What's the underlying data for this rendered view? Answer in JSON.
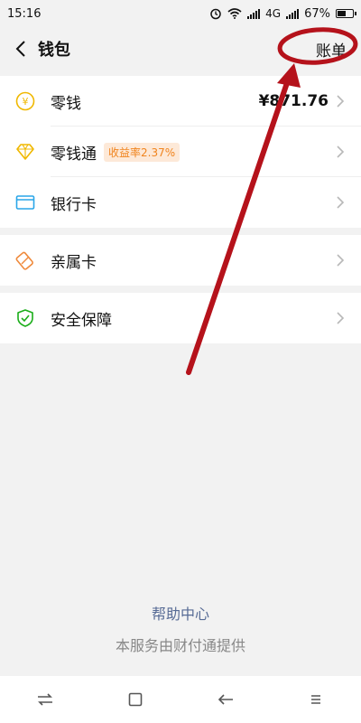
{
  "status_bar": {
    "time": "15:16",
    "network": "4G",
    "battery": "67%",
    "battery_level": 0.67,
    "icons": [
      "alarm-icon",
      "wifi-icon",
      "signal-icon",
      "battery-icon"
    ]
  },
  "header": {
    "title": "钱包",
    "bill_label": "账单"
  },
  "wallet": {
    "items": [
      {
        "label": "零钱",
        "value": "¥871.76",
        "icon": "yuan-coin-icon"
      },
      {
        "label": "零钱通",
        "badge": "收益率2.37%",
        "icon": "diamond-icon"
      },
      {
        "label": "银行卡",
        "icon": "bank-card-icon"
      }
    ]
  },
  "family": {
    "items": [
      {
        "label": "亲属卡",
        "icon": "family-card-icon"
      }
    ]
  },
  "security": {
    "items": [
      {
        "label": "安全保障",
        "icon": "shield-icon"
      }
    ]
  },
  "footer": {
    "help": "帮助中心",
    "provider": "本服务由财付通提供"
  },
  "colors": {
    "accent_link": "#576b95",
    "badge_text": "#f0841e",
    "badge_bg": "#fde9d8",
    "coin": "#f0b800",
    "card": "#2aa6e8",
    "family": "#ef8a3c",
    "shield": "#1aad19",
    "annotation": "#b5121b"
  }
}
